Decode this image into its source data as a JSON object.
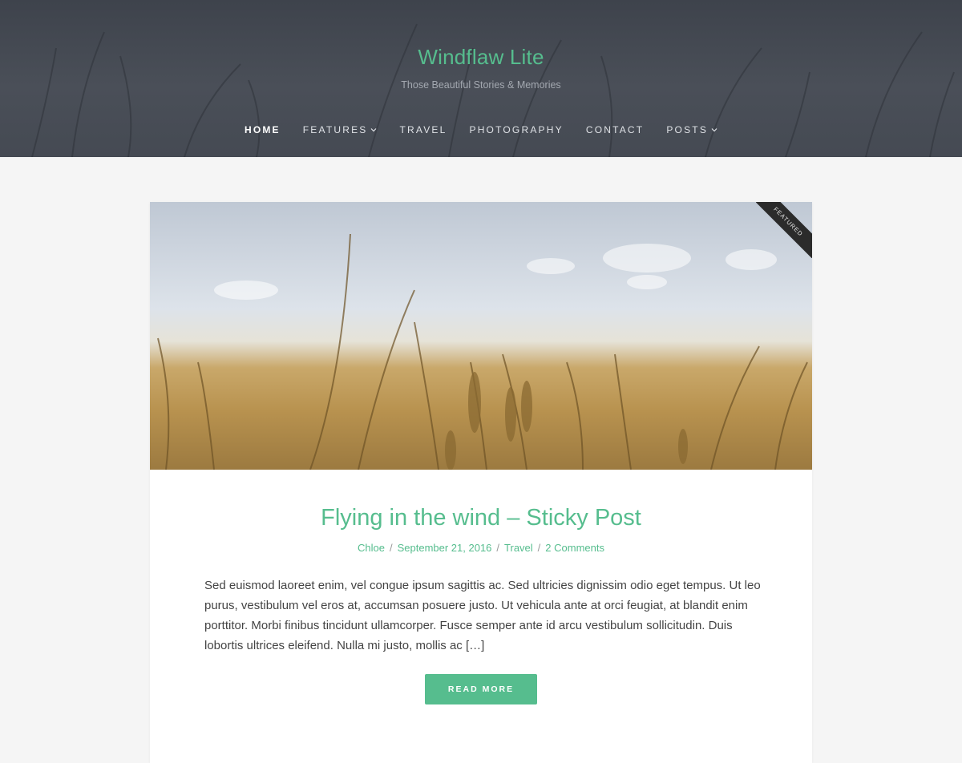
{
  "header": {
    "site_title": "Windflaw Lite",
    "tagline": "Those Beautiful Stories & Memories"
  },
  "nav": {
    "items": [
      {
        "label": "HOME",
        "active": true,
        "dropdown": false
      },
      {
        "label": "FEATURES",
        "active": false,
        "dropdown": true
      },
      {
        "label": "TRAVEL",
        "active": false,
        "dropdown": false
      },
      {
        "label": "PHOTOGRAPHY",
        "active": false,
        "dropdown": false
      },
      {
        "label": "CONTACT",
        "active": false,
        "dropdown": false
      },
      {
        "label": "POSTS",
        "active": false,
        "dropdown": true
      }
    ]
  },
  "post": {
    "badge": "FEATURED",
    "title": "Flying in the wind – Sticky Post",
    "author": "Chloe",
    "date": "September 21, 2016",
    "category": "Travel",
    "comments": "2 Comments",
    "excerpt": "Sed euismod laoreet enim, vel congue ipsum sagittis ac. Sed ultricies dignissim odio eget tempus. Ut leo purus, vestibulum vel eros at, accumsan posuere justo. Ut vehicula ante at orci feugiat, at blandit enim porttitor. Morbi finibus tincidunt ullamcorper. Fusce semper ante id arcu vestibulum sollicitudin. Duis lobortis ultrices eleifend. Nulla mi justo, mollis ac […]",
    "read_more": "READ MORE"
  },
  "colors": {
    "accent": "#56bd8e",
    "header_bg": "#454a53",
    "page_bg": "#f5f5f5"
  }
}
